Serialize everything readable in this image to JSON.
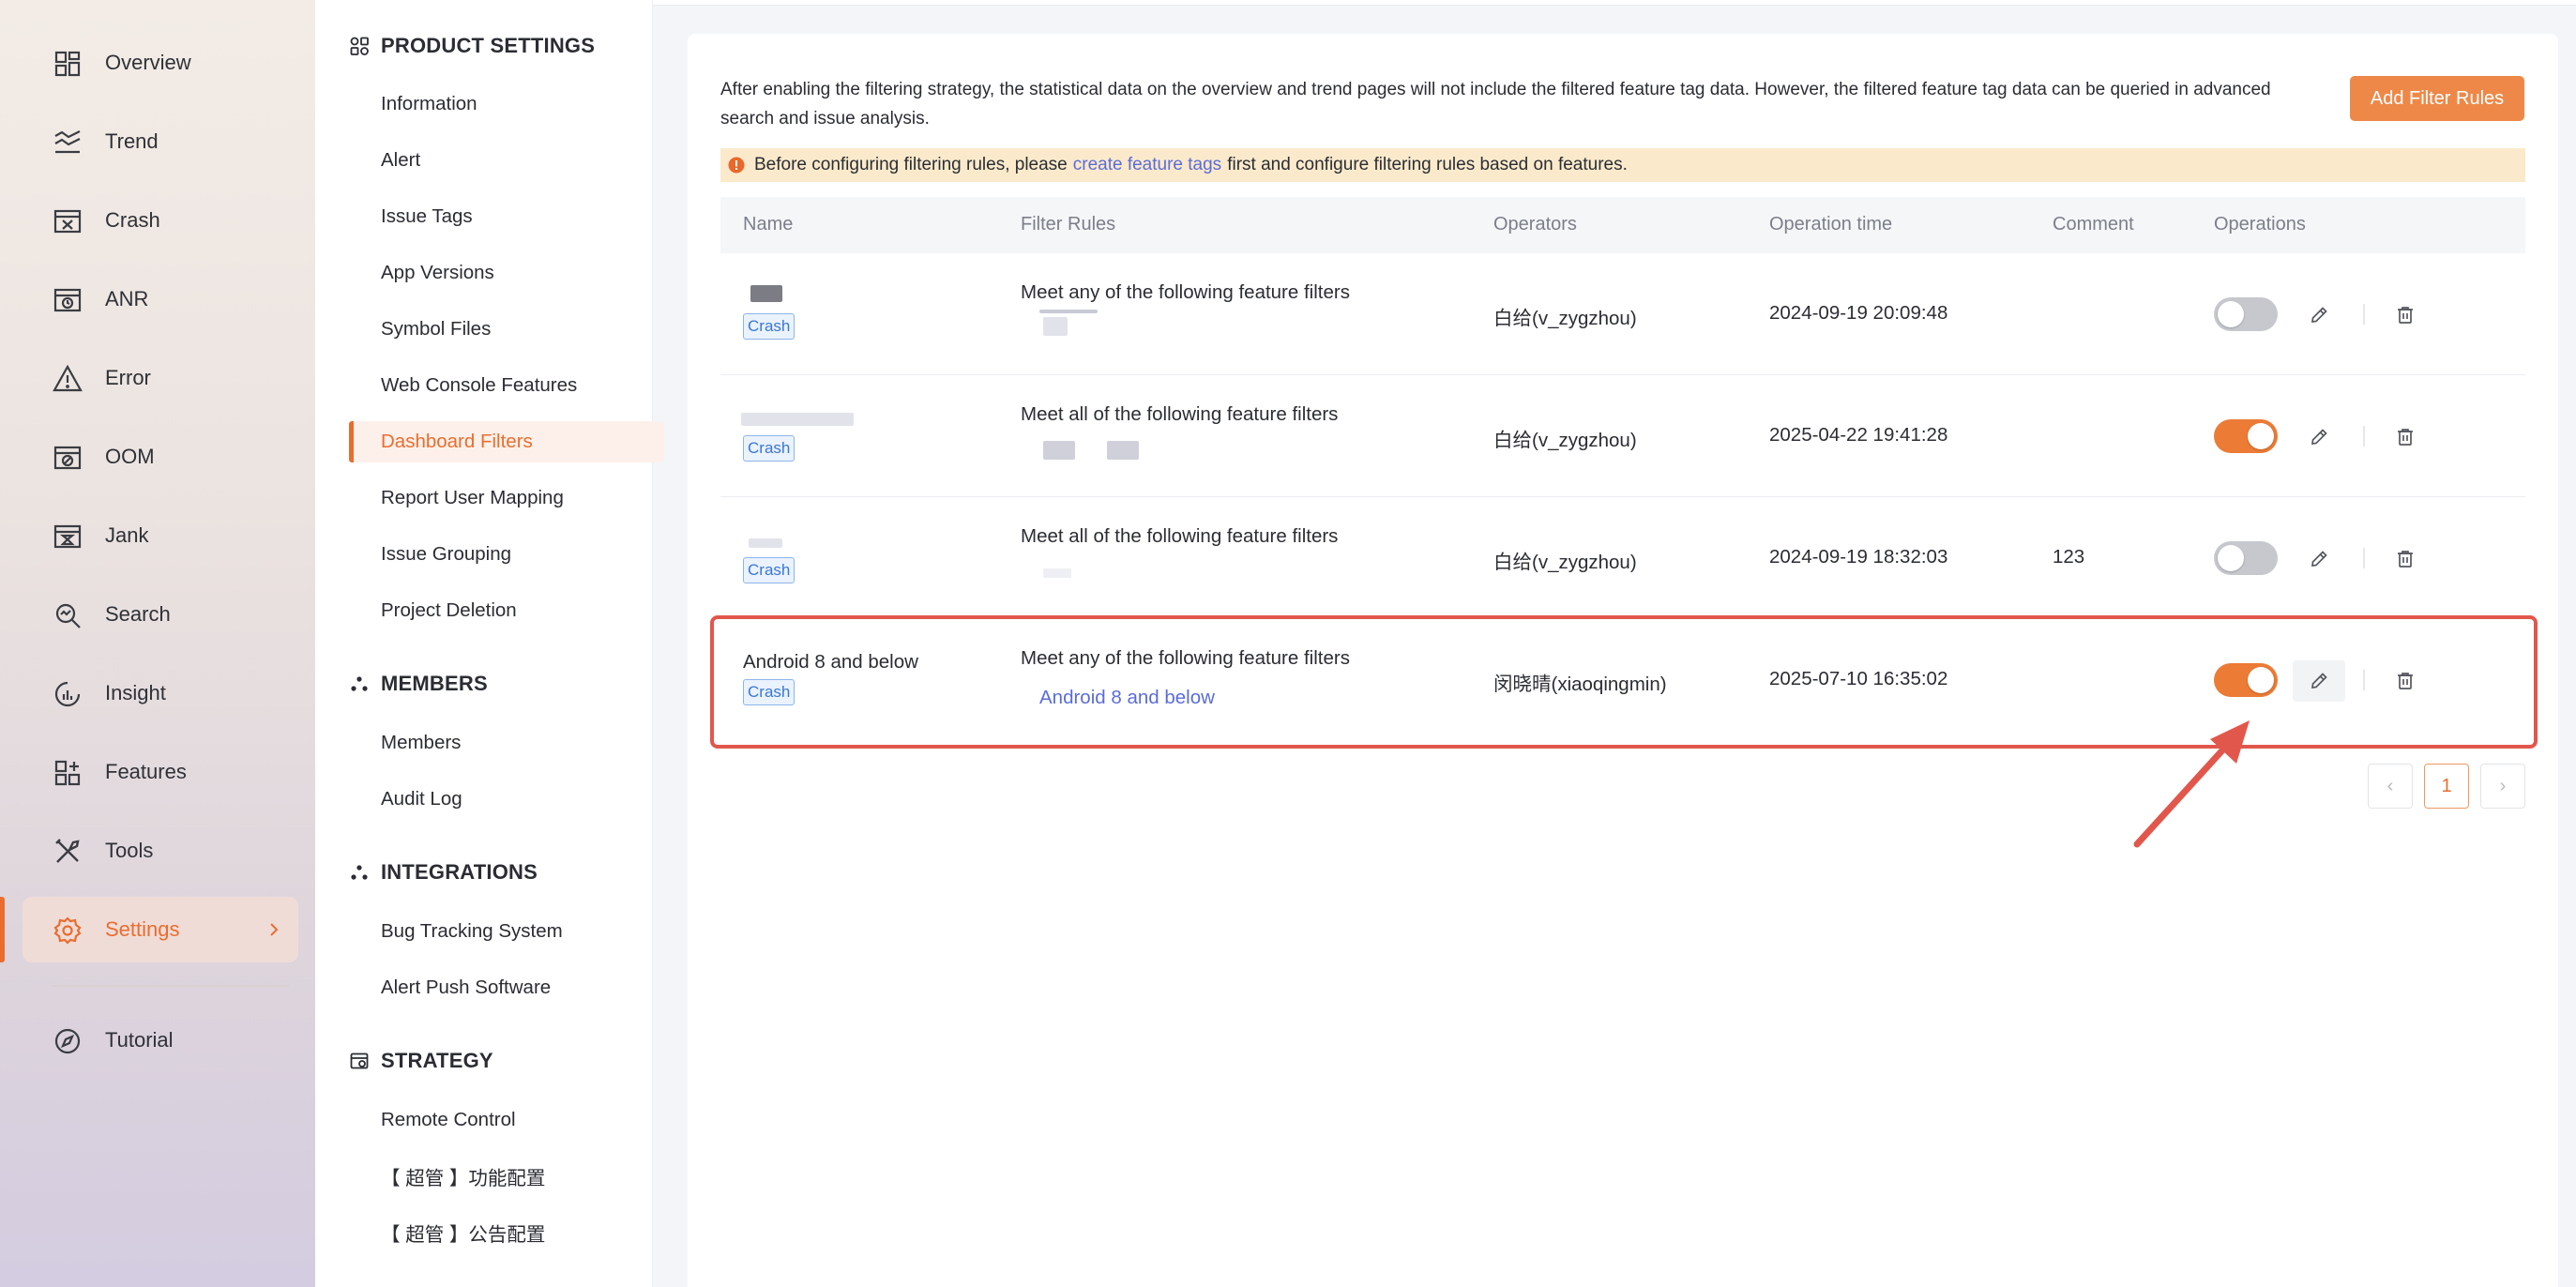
{
  "nav": {
    "items": [
      {
        "label": "Overview",
        "icon": "overview-icon"
      },
      {
        "label": "Trend",
        "icon": "trend-icon"
      },
      {
        "label": "Crash",
        "icon": "crash-icon"
      },
      {
        "label": "ANR",
        "icon": "anr-icon"
      },
      {
        "label": "Error",
        "icon": "error-icon"
      },
      {
        "label": "OOM",
        "icon": "oom-icon"
      },
      {
        "label": "Jank",
        "icon": "jank-icon"
      },
      {
        "label": "Search",
        "icon": "search-icon"
      },
      {
        "label": "Insight",
        "icon": "insight-icon"
      },
      {
        "label": "Features",
        "icon": "features-icon"
      },
      {
        "label": "Tools",
        "icon": "tools-icon"
      },
      {
        "label": "Settings",
        "icon": "gear-icon",
        "active": true
      },
      {
        "label": "Tutorial",
        "icon": "tutorial-icon"
      }
    ]
  },
  "submenu": {
    "product_settings": {
      "title": "PRODUCT SETTINGS",
      "items": [
        "Information",
        "Alert",
        "Issue Tags",
        "App Versions",
        "Symbol Files",
        "Web Console Features",
        "Dashboard Filters",
        "Report User Mapping",
        "Issue Grouping",
        "Project Deletion"
      ]
    },
    "members": {
      "title": "MEMBERS",
      "items": [
        "Members",
        "Audit Log"
      ]
    },
    "integrations": {
      "title": "INTEGRATIONS",
      "items": [
        "Bug Tracking System",
        "Alert Push Software"
      ]
    },
    "strategy": {
      "title": "STRATEGY",
      "items": [
        "Remote Control",
        "【 超管 】功能配置",
        "【 超管 】公告配置"
      ]
    }
  },
  "main": {
    "description": "After enabling the filtering strategy, the statistical data on the overview and trend pages will not include the filtered feature tag data. However, the filtered feature tag data can be queried in advanced search and issue analysis.",
    "add_button": "Add Filter Rules",
    "notice": {
      "before": "Before configuring filtering rules, please",
      "link": "create feature tags",
      "after": "first and configure filtering rules based on features."
    },
    "table": {
      "headers": [
        "Name",
        "Filter Rules",
        "Operators",
        "Operation time",
        "Comment",
        "Operations"
      ],
      "rows": [
        {
          "name": "",
          "tag": "Crash",
          "rule": "Meet any of the following feature filters",
          "filter": "",
          "operator": "白给(v_zygzhou)",
          "time": "2024-09-19 20:09:48",
          "comment": "",
          "enabled": false
        },
        {
          "name": "",
          "tag": "Crash",
          "rule": "Meet all of the following feature filters",
          "filter": "",
          "operator": "白给(v_zygzhou)",
          "time": "2025-04-22 19:41:28",
          "comment": "",
          "enabled": true
        },
        {
          "name": "",
          "tag": "Crash",
          "rule": "Meet all of the following feature filters",
          "filter": "",
          "operator": "白给(v_zygzhou)",
          "time": "2024-09-19 18:32:03",
          "comment": "123",
          "enabled": false
        },
        {
          "name": "Android 8 and below",
          "tag": "Crash",
          "rule": "Meet any of the following feature filters",
          "filter": "Android 8 and below",
          "operator": "闵晓晴(xiaoqingmin)",
          "time": "2025-07-10 16:35:02",
          "comment": "",
          "enabled": true
        }
      ]
    },
    "pagination": {
      "prev": "‹",
      "current": "1",
      "next": "›"
    }
  },
  "colors": {
    "accent": "#ea6d2f",
    "link": "#5b6cd9",
    "highlight": "#e2574c",
    "notice_bg": "#faeacb"
  }
}
